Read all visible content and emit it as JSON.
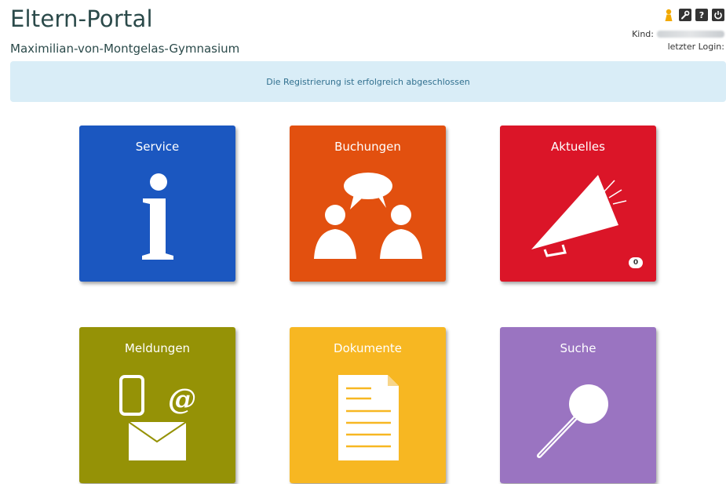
{
  "header": {
    "app_title": "Eltern-Portal",
    "school_name": "Maximilian-von-Montgelas-Gymnasium",
    "kind_label": "Kind:",
    "last_login_label": "letzter Login:",
    "icons": [
      "user-icon",
      "wrench-icon",
      "help-icon",
      "power-icon"
    ]
  },
  "alert": {
    "message": "Die Registrierung ist erfolgreich abgeschlossen"
  },
  "tiles": [
    {
      "label": "Service",
      "color": "#1b57c0"
    },
    {
      "label": "Buchungen",
      "color": "#e2500f"
    },
    {
      "label": "Aktuelles",
      "color": "#db1528",
      "badge": "0"
    },
    {
      "label": "Meldungen",
      "color": "#959206"
    },
    {
      "label": "Dokumente",
      "color": "#f7b722"
    },
    {
      "label": "Suche",
      "color": "#9a74c1"
    }
  ]
}
